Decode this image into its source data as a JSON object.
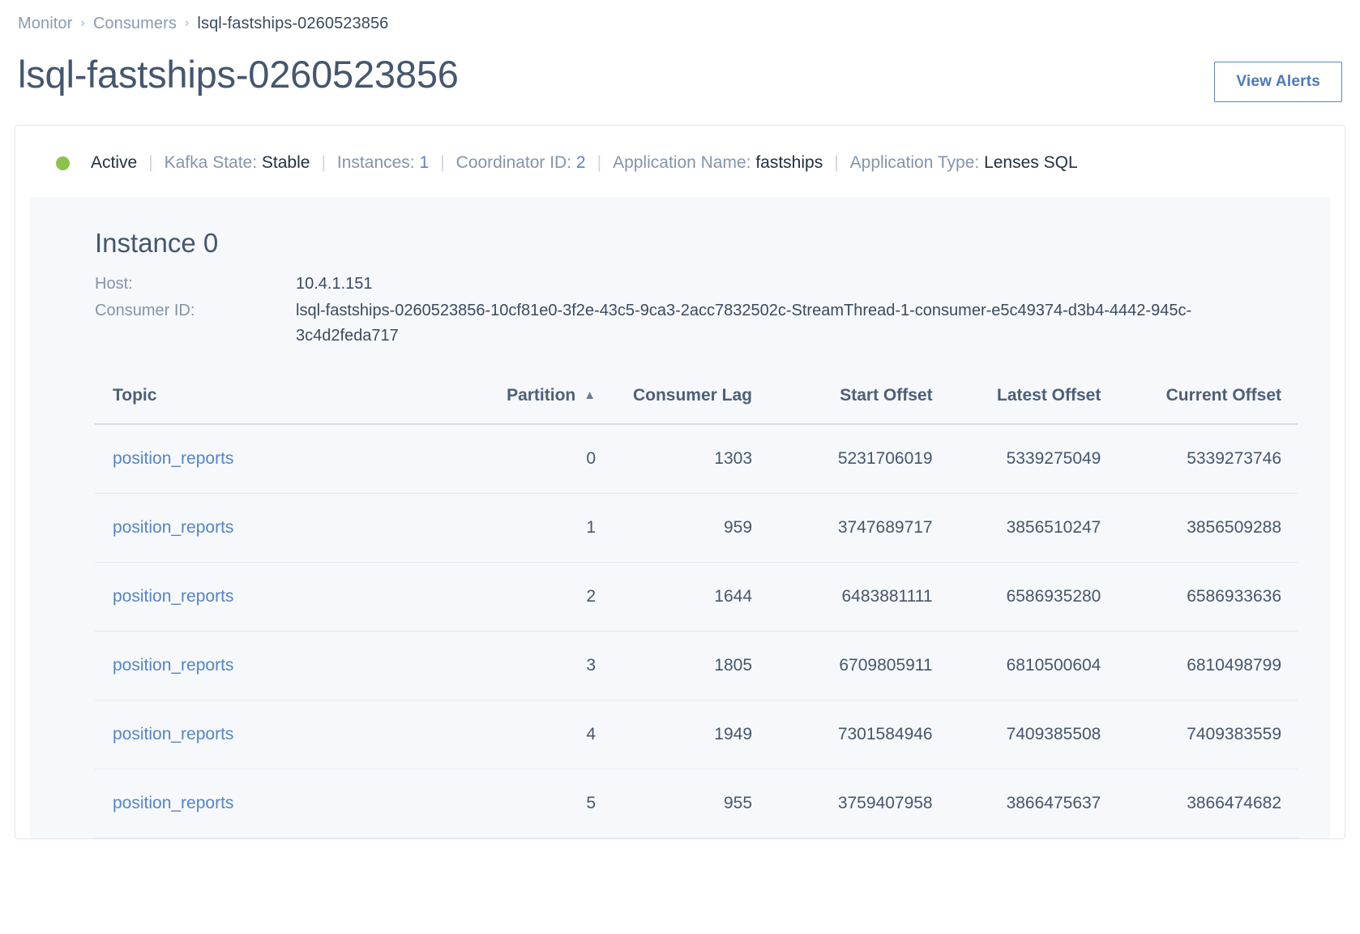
{
  "breadcrumb": {
    "items": [
      {
        "label": "Monitor",
        "current": false
      },
      {
        "label": "Consumers",
        "current": false
      },
      {
        "label": "lsql-fastships-0260523856",
        "current": true
      }
    ],
    "separator": "›"
  },
  "header": {
    "title": "lsql-fastships-0260523856",
    "view_alerts_label": "View Alerts"
  },
  "status": {
    "state_label": "Active",
    "dot_color": "#8bc34a",
    "divider": "|",
    "items": [
      {
        "label": "Kafka State:",
        "value": "Stable",
        "accent": false
      },
      {
        "label": "Instances:",
        "value": "1",
        "accent": true
      },
      {
        "label": "Coordinator ID:",
        "value": "2",
        "accent": true
      },
      {
        "label": "Application Name:",
        "value": "fastships",
        "accent": false
      },
      {
        "label": "Application Type:",
        "value": "Lenses SQL",
        "accent": false
      }
    ]
  },
  "instance": {
    "title": "Instance 0",
    "host_label": "Host:",
    "host_value": "10.4.1.151",
    "consumer_id_label": "Consumer ID:",
    "consumer_id_value": "lsql-fastships-0260523856-10cf81e0-3f2e-43c5-9ca3-2acc7832502c-StreamThread-1-consumer-e5c49374-d3b4-4442-945c-3c4d2feda717"
  },
  "table": {
    "columns": [
      {
        "key": "topic",
        "label": "Topic",
        "sorted": false
      },
      {
        "key": "partition",
        "label": "Partition",
        "sorted": true,
        "sort_dir": "asc",
        "sort_glyph": "▲"
      },
      {
        "key": "lag",
        "label": "Consumer Lag",
        "sorted": false
      },
      {
        "key": "start",
        "label": "Start Offset",
        "sorted": false
      },
      {
        "key": "latest",
        "label": "Latest Offset",
        "sorted": false
      },
      {
        "key": "current",
        "label": "Current Offset",
        "sorted": false
      }
    ],
    "rows": [
      {
        "topic": "position_reports",
        "partition": "0",
        "lag": "1303",
        "start": "5231706019",
        "latest": "5339275049",
        "current": "5339273746"
      },
      {
        "topic": "position_reports",
        "partition": "1",
        "lag": "959",
        "start": "3747689717",
        "latest": "3856510247",
        "current": "3856509288"
      },
      {
        "topic": "position_reports",
        "partition": "2",
        "lag": "1644",
        "start": "6483881111",
        "latest": "6586935280",
        "current": "6586933636"
      },
      {
        "topic": "position_reports",
        "partition": "3",
        "lag": "1805",
        "start": "6709805911",
        "latest": "6810500604",
        "current": "6810498799"
      },
      {
        "topic": "position_reports",
        "partition": "4",
        "lag": "1949",
        "start": "7301584946",
        "latest": "7409385508",
        "current": "7409383559"
      },
      {
        "topic": "position_reports",
        "partition": "5",
        "lag": "955",
        "start": "3759407958",
        "latest": "3866475637",
        "current": "3866474682"
      }
    ]
  },
  "colors": {
    "link": "#5485c6",
    "accent": "#4b79bd",
    "status_ok": "#8bc34a",
    "text": "#3b4a5f",
    "muted": "#8494ac",
    "panel_bg": "#f6f8fb"
  }
}
